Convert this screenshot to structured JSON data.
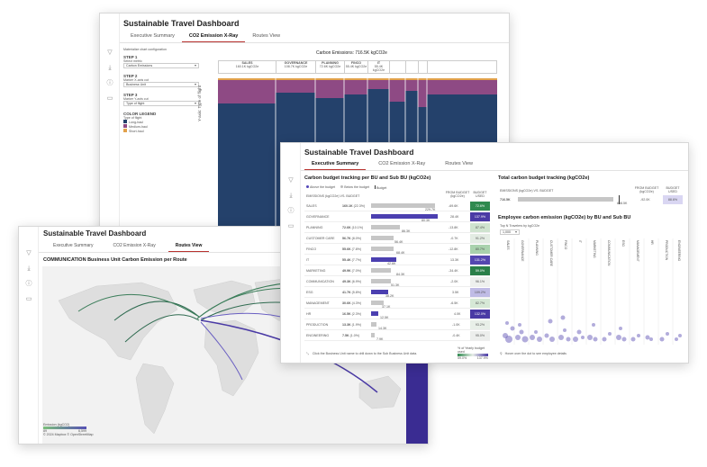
{
  "app_title": "Sustainable Travel Dashboard",
  "tabs": [
    "Executive Summary",
    "CO2 Emission X-Ray",
    "Routes View"
  ],
  "xray": {
    "config_title": "Materialize chart configuration",
    "steps": [
      {
        "label": "STEP 1",
        "hint": "Select metric",
        "value": "Carbon Emissions"
      },
      {
        "label": "STEP 2",
        "hint": "Marker X-axis cut",
        "value": "Business Unit"
      },
      {
        "label": "STEP 3",
        "hint": "Marker Y-axis cut",
        "value": "Type of flight"
      }
    ],
    "legend_title": "COLOR LEGEND",
    "legend_subtitle": "Type of flight",
    "legend_items": [
      {
        "label": "Long-haul",
        "color": "#24416b"
      },
      {
        "label": "Medium-haul",
        "color": "#8e4a84"
      },
      {
        "label": "Short-haul",
        "color": "#e2a14a"
      }
    ],
    "chart_title": "Carbon Emissions: 716.5K kgCO2e",
    "y_axis_label": "Y-axis: Type of flight",
    "columns": [
      {
        "name": "SALES",
        "value": "160.1K kgCO2e"
      },
      {
        "name": "GOVERNANCE",
        "value": "108.7K kgCO2e"
      },
      {
        "name": "PLANNING",
        "value": "72.6K kgCO2e"
      },
      {
        "name": "FINCO",
        "value": "55.4K kgCO2e"
      },
      {
        "name": "IT",
        "value": "55.4K kgCO2e"
      }
    ]
  },
  "routes": {
    "heading": "COMMUNICATION Business Unit Carbon Emission per Route",
    "legend_title": "Emission (kgCO2)",
    "legend_min": "89",
    "legend_max": "6,599",
    "credit": "© 2024 Mapbox  © OpenStreetMap"
  },
  "exec": {
    "bu_title": "Carbon budget tracking per BU and Sub BU (kgCO2e)",
    "legend_above": "Above the budget",
    "legend_below": "Below the budget",
    "legend_budget": "Budget",
    "col_emissions": "EMISSIONS (kgCO2e) VS. BUDGET",
    "col_from": "FROM BUDGET (kgCO2e)",
    "col_used": "BUDGET USED",
    "rows": [
      {
        "name": "SALES",
        "value": "160.1K",
        "pct": "(22.3%)",
        "budget": "229.7K",
        "from": "-69.6K",
        "used": "72.6%"
      },
      {
        "name": "GOVERNANCE",
        "value": "108.7K",
        "pct": "(15.2%)",
        "budget": "80.3K",
        "from": "28.4K",
        "used": "137.9%"
      },
      {
        "name": "PLANNING",
        "value": "72.6K",
        "pct": "(10.1%)",
        "budget": "86.3K",
        "from": "-13.8K",
        "used": "87.4%"
      },
      {
        "name": "CUSTOMER CARE",
        "value": "56.7K",
        "pct": "(8.0%)",
        "budget": "56.4K",
        "from": "-0.7K",
        "used": "91.2%"
      },
      {
        "name": "FINCO",
        "value": "55.6K",
        "pct": "(7.8%)",
        "budget": "68.4K",
        "from": "-12.8K",
        "used": "80.7%"
      },
      {
        "name": "IT",
        "value": "55.4K",
        "pct": "(7.7%)",
        "budget": "42.6K",
        "from": "13.3K",
        "used": "131.2%"
      },
      {
        "name": "MARKETING",
        "value": "49.9K",
        "pct": "(7.0%)",
        "budget": "84.3K",
        "from": "-34.4K",
        "used": "59.0%"
      },
      {
        "name": "COMMUNICATION",
        "value": "49.3K",
        "pct": "(6.9%)",
        "budget": "51.3K",
        "from": "-2.0K",
        "used": "96.1%"
      },
      {
        "name": "ESG",
        "value": "41.7K",
        "pct": "(5.8%)",
        "budget": "38.2K",
        "from": "3.5K",
        "used": "109.2%"
      },
      {
        "name": "MANAGEMENT",
        "value": "30.6K",
        "pct": "(4.3%)",
        "budget": "37.1K",
        "from": "-6.5K",
        "used": "82.7%"
      },
      {
        "name": "HR",
        "value": "16.5K",
        "pct": "(2.3%)",
        "budget": "12.5K",
        "from": "4.0K",
        "used": "132.0%"
      },
      {
        "name": "PRODUCTION",
        "value": "13.3K",
        "pct": "(1.9%)",
        "budget": "14.3K",
        "from": "-1.0K",
        "used": "93.2%"
      },
      {
        "name": "ENGINEERING",
        "value": "7.5K",
        "pct": "(1.0%)",
        "budget": "7.9K",
        "from": "-0.4K",
        "used": "95.0%"
      }
    ],
    "footer_hint": "Click the Business Unit name to drill down to the Sub Business Unit data.",
    "scale_title": "% of Yearly budget used",
    "scale_min": "59.0%",
    "scale_max": "137.9%",
    "total_title": "Total carbon budget tracking (kgCO2e)",
    "total_col": "EMISSIONS (kgCO2e) VS. BUDGET",
    "total_value": "716.5K",
    "total_budget": "808.5K",
    "total_from_label": "FROM BUDGET (kgCO2e)",
    "total_from": "-92.0K",
    "total_used_label": "BUDGET USED",
    "total_used": "88.6%",
    "scatter_title": "Employee carbon emission (kgCO2e) by BU and Sub BU",
    "scatter_sub": "Top N Travelers by kgCO2e",
    "scatter_n": "1,000",
    "scatter_columns": [
      "SALES",
      "GOVERNANCE",
      "PLANNING",
      "CUSTOMER CARE",
      "FINCO",
      "IT",
      "MARKETING",
      "COMMUNICATION",
      "ESG",
      "MANAGEMENT",
      "HR",
      "PRODUCTION",
      "ENGINEERING"
    ],
    "scatter_hint": "Hover over the dot to see employee details"
  }
}
